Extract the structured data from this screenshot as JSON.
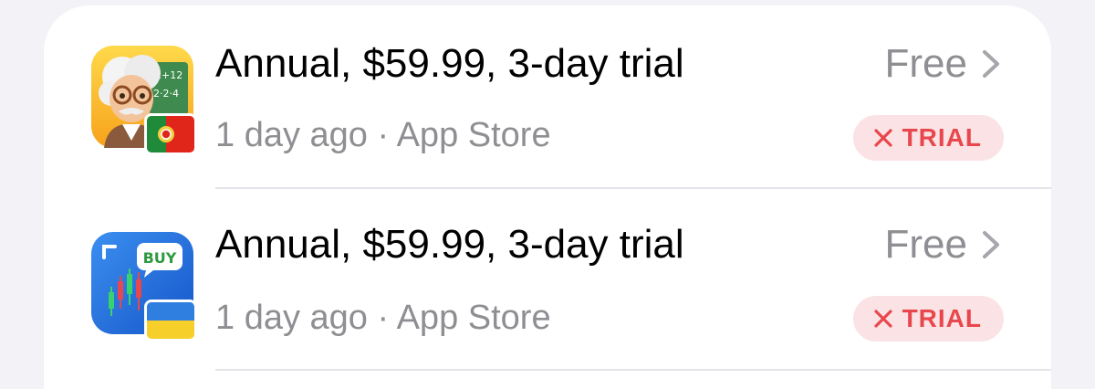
{
  "colors": {
    "background": "#f2f2f7",
    "card": "#ffffff",
    "title_text": "#000000",
    "secondary_text": "#8e8e93",
    "badge_bg": "#fbe3e5",
    "badge_text": "#e8484d"
  },
  "transactions": [
    {
      "app_icon": "einstein-math-app-icon",
      "flag_icon": "portugal-flag-icon",
      "title": "Annual, $59.99, 3-day trial",
      "subtitle": "1 day ago · App Store",
      "price": "Free",
      "badge": "TRIAL",
      "badge_icon": "x-icon",
      "chevron_icon": "chevron-right-icon"
    },
    {
      "app_icon": "stock-trading-app-icon",
      "app_icon_text": "BUY",
      "flag_icon": "ukraine-flag-icon",
      "title": "Annual, $59.99, 3-day trial",
      "subtitle": "1 day ago · App Store",
      "price": "Free",
      "badge": "TRIAL",
      "badge_icon": "x-icon",
      "chevron_icon": "chevron-right-icon"
    }
  ]
}
